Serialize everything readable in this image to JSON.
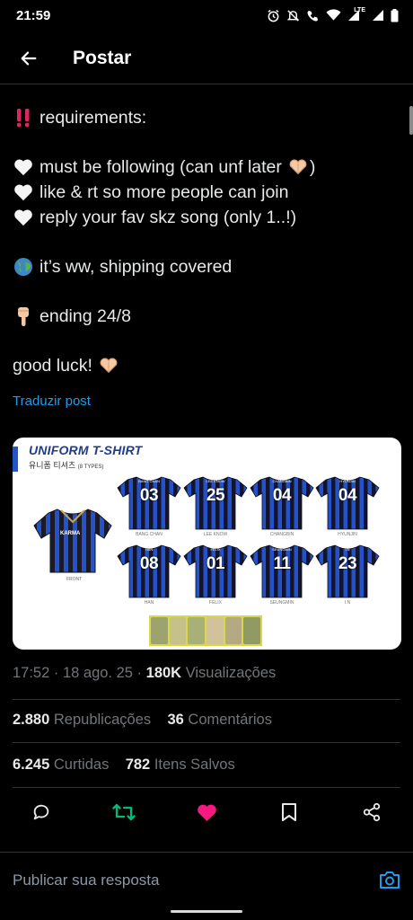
{
  "status_bar": {
    "time": "21:59",
    "network": "LTE"
  },
  "header": {
    "title": "Postar"
  },
  "post": {
    "lines": {
      "l1": "requirements:",
      "l2": "must be following (can unf later",
      "l2_end": ")",
      "l3": "like & rt so more people can join",
      "l4": "reply your fav skz song (only 1..!)",
      "l5": "it’s ww, shipping covered",
      "l6": "ending 24/8",
      "l7": "good luck!"
    },
    "translate_label": "Traduzir post"
  },
  "media": {
    "title": "UNIFORM T-SHIRT",
    "subtitle": "유니폼 티셔츠",
    "subtitle_types": "(8 TYPES)",
    "front_brand": "KARMA",
    "front_label": "FRONT",
    "jerseys": [
      {
        "name": "BANG CHAN",
        "number": "03",
        "caption": "BANG CHAN"
      },
      {
        "name": "LEE KNOW",
        "number": "25",
        "caption": "LEE KNOW"
      },
      {
        "name": "CHANGBIN",
        "number": "04",
        "caption": "CHANGBIN"
      },
      {
        "name": "HYUNJIN",
        "number": "04",
        "caption": "HYUNJIN"
      },
      {
        "name": "HAN",
        "number": "08",
        "caption": "HAN"
      },
      {
        "name": "FELIX",
        "number": "01",
        "caption": "FELIX"
      },
      {
        "name": "SEUNGMIN",
        "number": "11",
        "caption": "SEUNGMIN"
      },
      {
        "name": "I.N",
        "number": "23",
        "caption": "I.N"
      }
    ]
  },
  "meta": {
    "time": "17:52",
    "date": "18 ago. 25",
    "views_count": "180K",
    "views_label": "Visualizações"
  },
  "stats": {
    "reposts_count": "2.880",
    "reposts_label": "Republicações",
    "comments_count": "36",
    "comments_label": "Comentários",
    "likes_count": "6.245",
    "likes_label": "Curtidas",
    "saves_count": "782",
    "saves_label": "Itens Salvos"
  },
  "reply": {
    "placeholder": "Publicar sua resposta"
  },
  "colors": {
    "accent": "#1d9bf0",
    "repost": "#00ba7c",
    "like": "#f91880",
    "muted": "#71767b"
  },
  "icons": [
    "back-arrow-icon",
    "alarm-icon",
    "mute-icon",
    "wifi-call-icon",
    "wifi-icon",
    "signal-icon",
    "battery-icon",
    "reply-icon",
    "repost-icon",
    "heart-icon",
    "bookmark-icon",
    "share-icon",
    "camera-icon"
  ]
}
